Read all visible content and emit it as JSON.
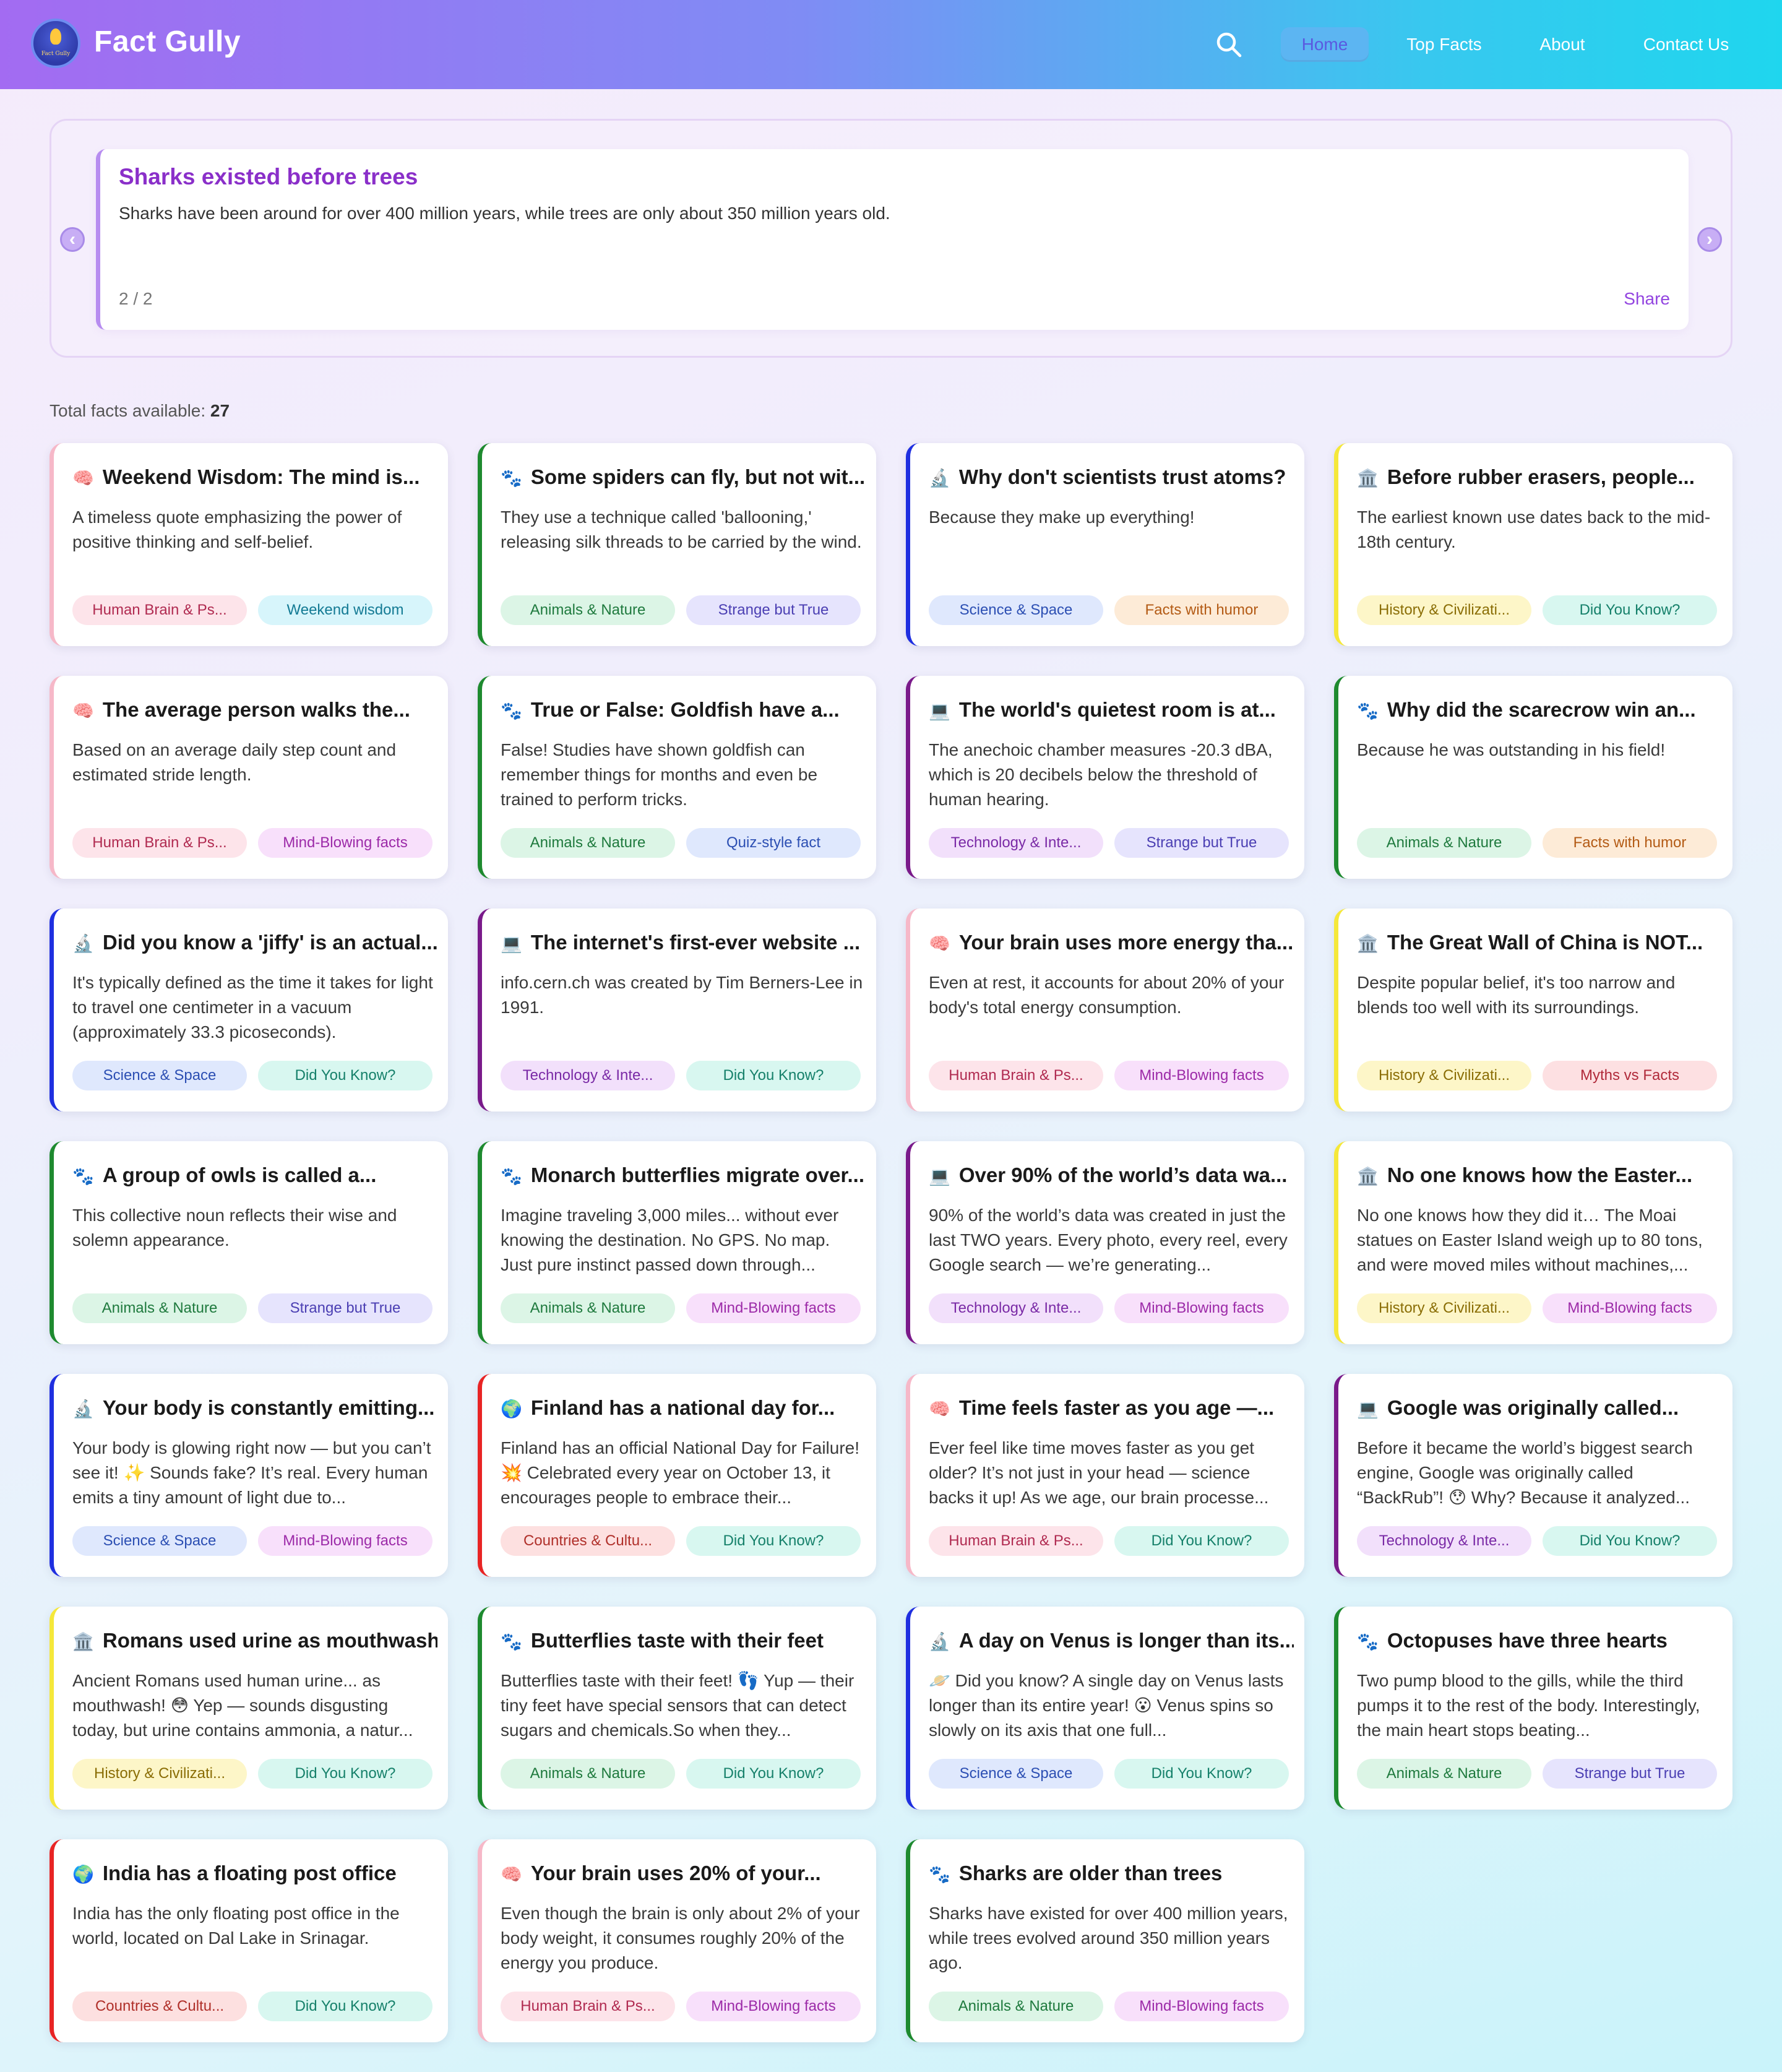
{
  "header": {
    "brand": "Fact Gully",
    "logo_text": "Fact Gully",
    "nav": [
      {
        "label": "Home",
        "active": true
      },
      {
        "label": "Top Facts",
        "active": false
      },
      {
        "label": "About",
        "active": false
      },
      {
        "label": "Contact Us",
        "active": false
      }
    ]
  },
  "carousel": {
    "title": "Sharks existed before trees",
    "text": "Sharks have been around for over 400 million years, while trees are only about 350 million years old.",
    "counter": "2 / 2",
    "share": "Share",
    "prev_icon": "chevron-left-icon",
    "next_icon": "chevron-right-icon"
  },
  "total": {
    "label": "Total facts available: ",
    "count": "27"
  },
  "category_colors": {
    "brain": "#f6b8c8",
    "animals": "#1e8a2f",
    "science": "#1f2fe0",
    "history": "#f5e83a",
    "tech": "#7a1a8a",
    "countries": "#e82424"
  },
  "tag_styles": {
    "brain": {
      "bg": "#fde4ea",
      "fg": "#b02a50"
    },
    "animals": {
      "bg": "#dcf5e6",
      "fg": "#1f7a3e"
    },
    "science": {
      "bg": "#dfe8fd",
      "fg": "#2c4fb3"
    },
    "history": {
      "bg": "#fdf6c8",
      "fg": "#8a6d05"
    },
    "tech": {
      "bg": "#f2e0fb",
      "fg": "#7a2aa6"
    },
    "countries": {
      "bg": "#fde0e0",
      "fg": "#b0302a"
    },
    "weekend": {
      "bg": "#d7f5fb",
      "fg": "#137a94"
    },
    "strange": {
      "bg": "#e6e4fd",
      "fg": "#4b3fb3"
    },
    "humor": {
      "bg": "#fdebd7",
      "fg": "#b35a14"
    },
    "didyouknow": {
      "bg": "#d8f7f0",
      "fg": "#15806a"
    },
    "mind": {
      "bg": "#f8e0fb",
      "fg": "#9c2aa8"
    },
    "quiz": {
      "bg": "#dfe8fd",
      "fg": "#2c4fb3"
    },
    "myths": {
      "bg": "#fde0e2",
      "fg": "#b02a3a"
    }
  },
  "cards": [
    {
      "icon": "brain-icon",
      "emoji": "🧠",
      "cat": "brain",
      "title": "Weekend Wisdom: The mind is...",
      "desc": "A timeless quote emphasizing the power of positive thinking and self-belief.",
      "tags": [
        {
          "label": "Human Brain & Ps...",
          "style": "brain"
        },
        {
          "label": "Weekend wisdom",
          "style": "weekend"
        }
      ]
    },
    {
      "icon": "paw-icon",
      "emoji": "🐾",
      "cat": "animals",
      "title": "Some spiders can fly, but not wit...",
      "desc": "They use a technique called 'ballooning,' releasing silk threads to be carried by the wind.",
      "tags": [
        {
          "label": "Animals & Nature",
          "style": "animals"
        },
        {
          "label": "Strange but True",
          "style": "strange"
        }
      ]
    },
    {
      "icon": "microscope-icon",
      "emoji": "🔬",
      "cat": "science",
      "title": "Why don't scientists trust atoms?",
      "desc": "Because they make up everything!",
      "tags": [
        {
          "label": "Science & Space",
          "style": "science"
        },
        {
          "label": "Facts with humor",
          "style": "humor"
        }
      ]
    },
    {
      "icon": "classical-building-icon",
      "emoji": "🏛️",
      "cat": "history",
      "title": "Before rubber erasers, people...",
      "desc": "The earliest known use dates back to the mid-18th century.",
      "tags": [
        {
          "label": "History & Civilizati...",
          "style": "history"
        },
        {
          "label": "Did You Know?",
          "style": "didyouknow"
        }
      ]
    },
    {
      "icon": "brain-icon",
      "emoji": "🧠",
      "cat": "brain",
      "title": "The average person walks the...",
      "desc": "Based on an average daily step count and estimated stride length.",
      "tags": [
        {
          "label": "Human Brain & Ps...",
          "style": "brain"
        },
        {
          "label": "Mind-Blowing facts",
          "style": "mind"
        }
      ]
    },
    {
      "icon": "paw-icon",
      "emoji": "🐾",
      "cat": "animals",
      "title": "True or False: Goldfish have a...",
      "desc": "False! Studies have shown goldfish can remember things for months and even be trained to perform tricks.",
      "tags": [
        {
          "label": "Animals & Nature",
          "style": "animals"
        },
        {
          "label": "Quiz-style fact",
          "style": "quiz"
        }
      ]
    },
    {
      "icon": "laptop-icon",
      "emoji": "💻",
      "cat": "tech",
      "title": "The world's quietest room is at...",
      "desc": "The anechoic chamber measures -20.3 dBA, which is 20 decibels below the threshold of human hearing.",
      "tags": [
        {
          "label": "Technology & Inte...",
          "style": "tech"
        },
        {
          "label": "Strange but True",
          "style": "strange"
        }
      ]
    },
    {
      "icon": "paw-icon",
      "emoji": "🐾",
      "cat": "animals",
      "title": "Why did the scarecrow win an...",
      "desc": "Because he was outstanding in his field!",
      "tags": [
        {
          "label": "Animals & Nature",
          "style": "animals"
        },
        {
          "label": "Facts with humor",
          "style": "humor"
        }
      ]
    },
    {
      "icon": "microscope-icon",
      "emoji": "🔬",
      "cat": "science",
      "title": "Did you know a 'jiffy' is an actual...",
      "desc": "It's typically defined as the time it takes for light to travel one centimeter in a vacuum (approximately 33.3 picoseconds).",
      "tags": [
        {
          "label": "Science & Space",
          "style": "science"
        },
        {
          "label": "Did You Know?",
          "style": "didyouknow"
        }
      ]
    },
    {
      "icon": "laptop-icon",
      "emoji": "💻",
      "cat": "tech",
      "title": "The internet's first-ever website ...",
      "desc": "info.cern.ch was created by Tim Berners-Lee in 1991.",
      "tags": [
        {
          "label": "Technology & Inte...",
          "style": "tech"
        },
        {
          "label": "Did You Know?",
          "style": "didyouknow"
        }
      ]
    },
    {
      "icon": "brain-icon",
      "emoji": "🧠",
      "cat": "brain",
      "title": "Your brain uses more energy tha...",
      "desc": "Even at rest, it accounts for about 20% of your body's total energy consumption.",
      "tags": [
        {
          "label": "Human Brain & Ps...",
          "style": "brain"
        },
        {
          "label": "Mind-Blowing facts",
          "style": "mind"
        }
      ]
    },
    {
      "icon": "classical-building-icon",
      "emoji": "🏛️",
      "cat": "history",
      "title": "The Great Wall of China is NOT...",
      "desc": "Despite popular belief, it's too narrow and blends too well with its surroundings.",
      "tags": [
        {
          "label": "History & Civilizati...",
          "style": "history"
        },
        {
          "label": "Myths vs Facts",
          "style": "myths"
        }
      ]
    },
    {
      "icon": "paw-icon",
      "emoji": "🐾",
      "cat": "animals",
      "title": "A group of owls is called a...",
      "desc": "This collective noun reflects their wise and solemn appearance.",
      "tags": [
        {
          "label": "Animals & Nature",
          "style": "animals"
        },
        {
          "label": "Strange but True",
          "style": "strange"
        }
      ]
    },
    {
      "icon": "paw-icon",
      "emoji": "🐾",
      "cat": "animals",
      "title": "Monarch butterflies migrate over...",
      "desc": "Imagine traveling 3,000 miles... without ever knowing the destination. No GPS. No map. Just pure instinct passed down through...",
      "tags": [
        {
          "label": "Animals & Nature",
          "style": "animals"
        },
        {
          "label": "Mind-Blowing facts",
          "style": "mind"
        }
      ]
    },
    {
      "icon": "laptop-icon",
      "emoji": "💻",
      "cat": "tech",
      "title": "Over 90% of the world’s data wa...",
      "desc": "90% of the world’s data was created in just the last TWO years. Every photo, every reel, every Google search — we’re generating...",
      "tags": [
        {
          "label": "Technology & Inte...",
          "style": "tech"
        },
        {
          "label": "Mind-Blowing facts",
          "style": "mind"
        }
      ]
    },
    {
      "icon": "classical-building-icon",
      "emoji": "🏛️",
      "cat": "history",
      "title": "No one knows how the Easter...",
      "desc": "No one knows how they did it… The Moai statues on Easter Island weigh up to 80 tons, and were moved miles without machines,...",
      "tags": [
        {
          "label": "History & Civilizati...",
          "style": "history"
        },
        {
          "label": "Mind-Blowing facts",
          "style": "mind"
        }
      ]
    },
    {
      "icon": "microscope-icon",
      "emoji": "🔬",
      "cat": "science",
      "title": "Your body is constantly emitting...",
      "desc": "Your body is glowing right now — but you can’t see it! ✨ Sounds fake? It’s real. Every human emits a tiny amount of light due to...",
      "tags": [
        {
          "label": "Science & Space",
          "style": "science"
        },
        {
          "label": "Mind-Blowing facts",
          "style": "mind"
        }
      ]
    },
    {
      "icon": "globe-icon",
      "emoji": "🌍",
      "cat": "countries",
      "title": "Finland has a national day for...",
      "desc": "Finland has an official National Day for Failure! 💥 Celebrated every year on October 13, it encourages people to embrace their...",
      "tags": [
        {
          "label": "Countries & Cultu...",
          "style": "countries"
        },
        {
          "label": "Did You Know?",
          "style": "didyouknow"
        }
      ]
    },
    {
      "icon": "brain-icon",
      "emoji": "🧠",
      "cat": "brain",
      "title": "Time feels faster as you age —...",
      "desc": "Ever feel like time moves faster as you get older? It’s not just in your head — science backs it up! As we age, our brain processe...",
      "tags": [
        {
          "label": "Human Brain & Ps...",
          "style": "brain"
        },
        {
          "label": "Did You Know?",
          "style": "didyouknow"
        }
      ]
    },
    {
      "icon": "laptop-icon",
      "emoji": "💻",
      "cat": "tech",
      "title": "Google was originally called...",
      "desc": "Before it became the world’s biggest search engine, Google was originally called “BackRub”! 😯 Why? Because it analyzed...",
      "tags": [
        {
          "label": "Technology & Inte...",
          "style": "tech"
        },
        {
          "label": "Did You Know?",
          "style": "didyouknow"
        }
      ]
    },
    {
      "icon": "classical-building-icon",
      "emoji": "🏛️",
      "cat": "history",
      "title": "Romans used urine as mouthwash",
      "desc": "Ancient Romans used human urine... as mouthwash! 😳 Yep — sounds disgusting today, but urine contains ammonia, a natur...",
      "tags": [
        {
          "label": "History & Civilizati...",
          "style": "history"
        },
        {
          "label": "Did You Know?",
          "style": "didyouknow"
        }
      ]
    },
    {
      "icon": "paw-icon",
      "emoji": "🐾",
      "cat": "animals",
      "title": "Butterflies taste with their feet",
      "desc": "Butterflies taste with their feet! 👣 Yup — their tiny feet have special sensors that can detect sugars and chemicals.So when they...",
      "tags": [
        {
          "label": "Animals & Nature",
          "style": "animals"
        },
        {
          "label": "Did You Know?",
          "style": "didyouknow"
        }
      ]
    },
    {
      "icon": "microscope-icon",
      "emoji": "🔬",
      "cat": "science",
      "title": "A day on Venus is longer than its...",
      "desc": "🪐 Did you know? A single day on Venus lasts longer than its entire year! 😮 Venus spins so slowly on its axis that one full...",
      "tags": [
        {
          "label": "Science & Space",
          "style": "science"
        },
        {
          "label": "Did You Know?",
          "style": "didyouknow"
        }
      ]
    },
    {
      "icon": "paw-icon",
      "emoji": "🐾",
      "cat": "animals",
      "title": "Octopuses have three hearts",
      "desc": "Two pump blood to the gills, while the third pumps it to the rest of the body. Interestingly, the main heart stops beating...",
      "tags": [
        {
          "label": "Animals & Nature",
          "style": "animals"
        },
        {
          "label": "Strange but True",
          "style": "strange"
        }
      ]
    },
    {
      "icon": "globe-icon",
      "emoji": "🌍",
      "cat": "countries",
      "title": "India has a floating post office",
      "desc": "India has the only floating post office in the world, located on Dal Lake in Srinagar.",
      "tags": [
        {
          "label": "Countries & Cultu...",
          "style": "countries"
        },
        {
          "label": "Did You Know?",
          "style": "didyouknow"
        }
      ]
    },
    {
      "icon": "brain-icon",
      "emoji": "🧠",
      "cat": "brain",
      "title": "Your brain uses 20% of your...",
      "desc": "Even though the brain is only about 2% of your body weight, it consumes roughly 20% of the energy you produce.",
      "tags": [
        {
          "label": "Human Brain & Ps...",
          "style": "brain"
        },
        {
          "label": "Mind-Blowing facts",
          "style": "mind"
        }
      ]
    },
    {
      "icon": "paw-icon",
      "emoji": "🐾",
      "cat": "animals",
      "title": "Sharks are older than trees",
      "desc": "Sharks have existed for over 400 million years, while trees evolved around 350 million years ago.",
      "tags": [
        {
          "label": "Animals & Nature",
          "style": "animals"
        },
        {
          "label": "Mind-Blowing facts",
          "style": "mind"
        }
      ]
    }
  ]
}
